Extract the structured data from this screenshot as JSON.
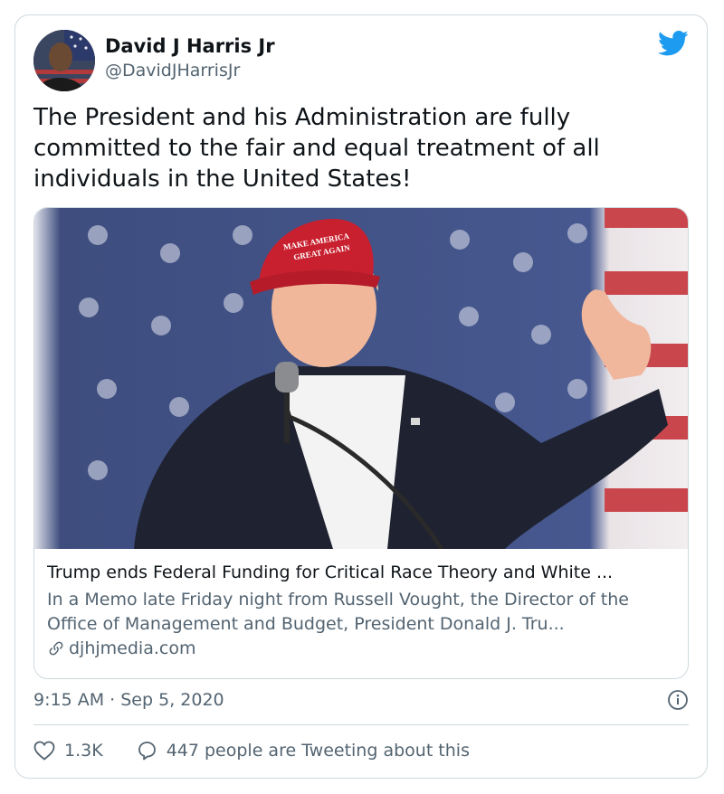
{
  "author": {
    "name": "David J Harris Jr",
    "handle": "@DavidJHarrisJr",
    "avatar_icon": "avatar-photo"
  },
  "brand": {
    "icon": "twitter-bird-icon",
    "color": "#1d9bf0"
  },
  "tweet": {
    "text": "The President and his Administration are fully committed to the fair and equal treatment of all individuals in the United States!"
  },
  "link_card": {
    "title": "Trump ends Federal Funding for Critical Race Theory and White ...",
    "description": "In a Memo late Friday night from Russell Vought, the Director of the Office of Management and Budget, President Donald J. Tru...",
    "domain": "djhjmedia.com",
    "cap_text_line1": "MAKE AMERICA",
    "cap_text_line2": "GREAT AGAIN"
  },
  "meta": {
    "time": "9:15 AM",
    "separator": "·",
    "date": "Sep 5, 2020"
  },
  "actions": {
    "likes": "1.3K",
    "conversation": "447 people are Tweeting about this"
  },
  "colors": {
    "text_primary": "#0f1419",
    "text_secondary": "#536471",
    "border": "#cfd9de"
  }
}
